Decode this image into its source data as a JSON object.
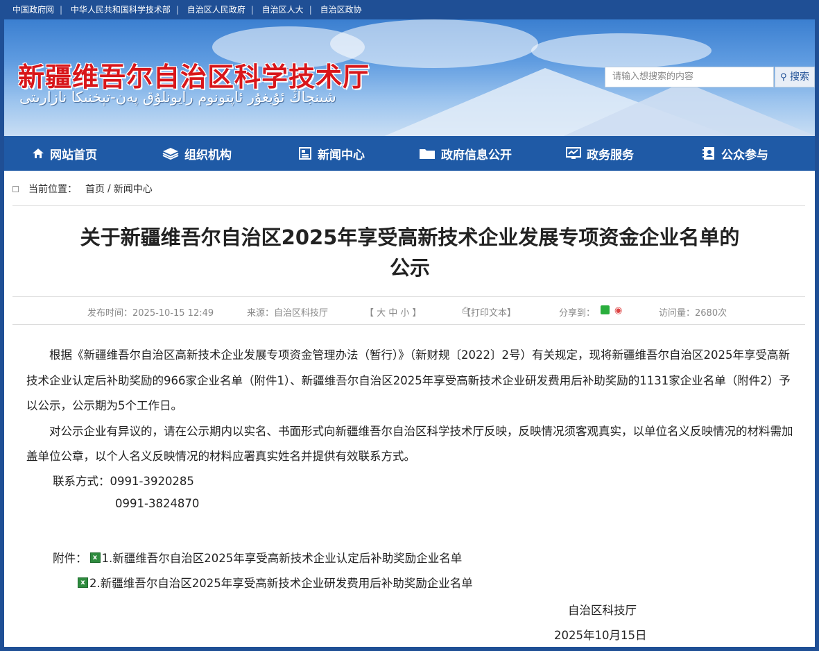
{
  "top_links": [
    "中国政府网",
    "中华人民共和国科学技术部",
    "自治区人民政府",
    "自治区人大",
    "自治区政协"
  ],
  "banner": {
    "title": "新疆维吾尔自治区科学技术厅",
    "subtitle": "شىنجاڭ ئۇيغۇر ئاپتونوم رايونلۇق پەن-تېخنىكا نازارىتى"
  },
  "search": {
    "placeholder": "请输入想搜索的内容",
    "button_label": "搜索"
  },
  "nav": [
    {
      "label": "网站首页",
      "icon": "home-icon"
    },
    {
      "label": "组织机构",
      "icon": "layers-icon"
    },
    {
      "label": "新闻中心",
      "icon": "news-icon"
    },
    {
      "label": "政府信息公开",
      "icon": "folder-icon"
    },
    {
      "label": "政务服务",
      "icon": "monitor-icon"
    },
    {
      "label": "公众参与",
      "icon": "contact-book-icon"
    }
  ],
  "breadcrumb": {
    "label": "当前位置：",
    "home": "首页",
    "sep": "/",
    "current": "新闻中心"
  },
  "article": {
    "title_line1": "关于新疆维吾尔自治区2025年享受高新技术企业发展专项资金企业名单的",
    "title_line2": "公示",
    "meta": {
      "publish": "发布时间：2025-10-15 12:49",
      "source": "来源：自治区科技厅",
      "font_size": "【 大  中  小 】",
      "print": "【打印文本】",
      "share": "分享到：",
      "views": "访问量：2680次"
    },
    "para1": "根据《新疆维吾尔自治区高新技术企业发展专项资金管理办法（暂行）》（新财规〔2022〕2号）有关规定，现将新疆维吾尔自治区2025年享受高新技术企业认定后补助奖励的966家企业名单（附件1）、新疆维吾尔自治区2025年享受高新技术企业研发费用后补助奖励的1131家企业名单（附件2）予以公示，公示期为5个工作日。",
    "para2": "对公示企业有异议的，请在公示期内以实名、书面形式向新疆维吾尔自治区科学技术厅反映，反映情况须客观真实，以单位名义反映情况的材料需加盖单位公章，以个人名义反映情况的材料应署真实姓名并提供有效联系方式。",
    "contact_label": "联系方式：",
    "phone1": "0991-3920285",
    "phone2": "0991-3824870",
    "attach_label": "附件：",
    "attach1": "1.新疆维吾尔自治区2025年享受高新技术企业认定后补助奖励企业名单",
    "attach2": "2.新疆维吾尔自治区2025年享受高新技术企业研发费用后补助奖励企业名单",
    "sign_org": "自治区科技厅",
    "sign_date": "2025年10月15日"
  },
  "colors": {
    "nav_bg": "#1f5aa6",
    "top_bar_bg": "#1f4f95",
    "title_red": "#d8161a"
  }
}
